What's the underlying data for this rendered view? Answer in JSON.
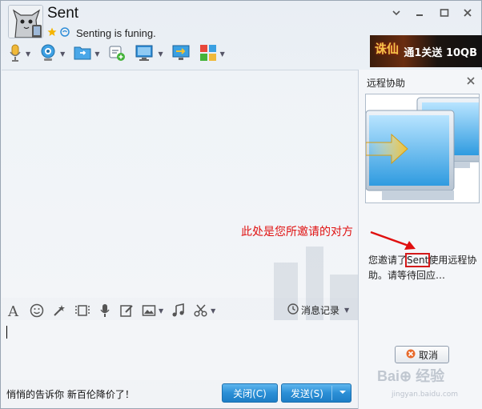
{
  "header": {
    "title": "Sent",
    "status_text": "Senting is funing."
  },
  "ad": {
    "logo_text": "诛仙",
    "text": "通1关送 10QB"
  },
  "toolbar": {
    "icons": [
      "microphone-icon",
      "video-camera-icon",
      "file-transfer-icon",
      "add-chat-icon",
      "remote-desktop-icon",
      "screen-share-icon",
      "apps-icon"
    ]
  },
  "input_toolbar": {
    "history_label": "消息记录"
  },
  "bottom": {
    "message": "悄悄的告诉你 新百伦降价了！",
    "close_label": "关闭(C)",
    "send_label": "发送(S)"
  },
  "panel": {
    "title": "远程协助",
    "message_pre": "您邀请了",
    "message_name": "Sent",
    "message_post": "使用远程协助。请等待回应…",
    "cancel_label": "取消"
  },
  "annotation": {
    "text": "此处是您所邀请的对方"
  },
  "watermark": {
    "text": "Bai⊕ 经验",
    "sub": "jingyan.baidu.com"
  },
  "colors": {
    "accent": "#2b8fd6",
    "annotation": "#e01010"
  }
}
